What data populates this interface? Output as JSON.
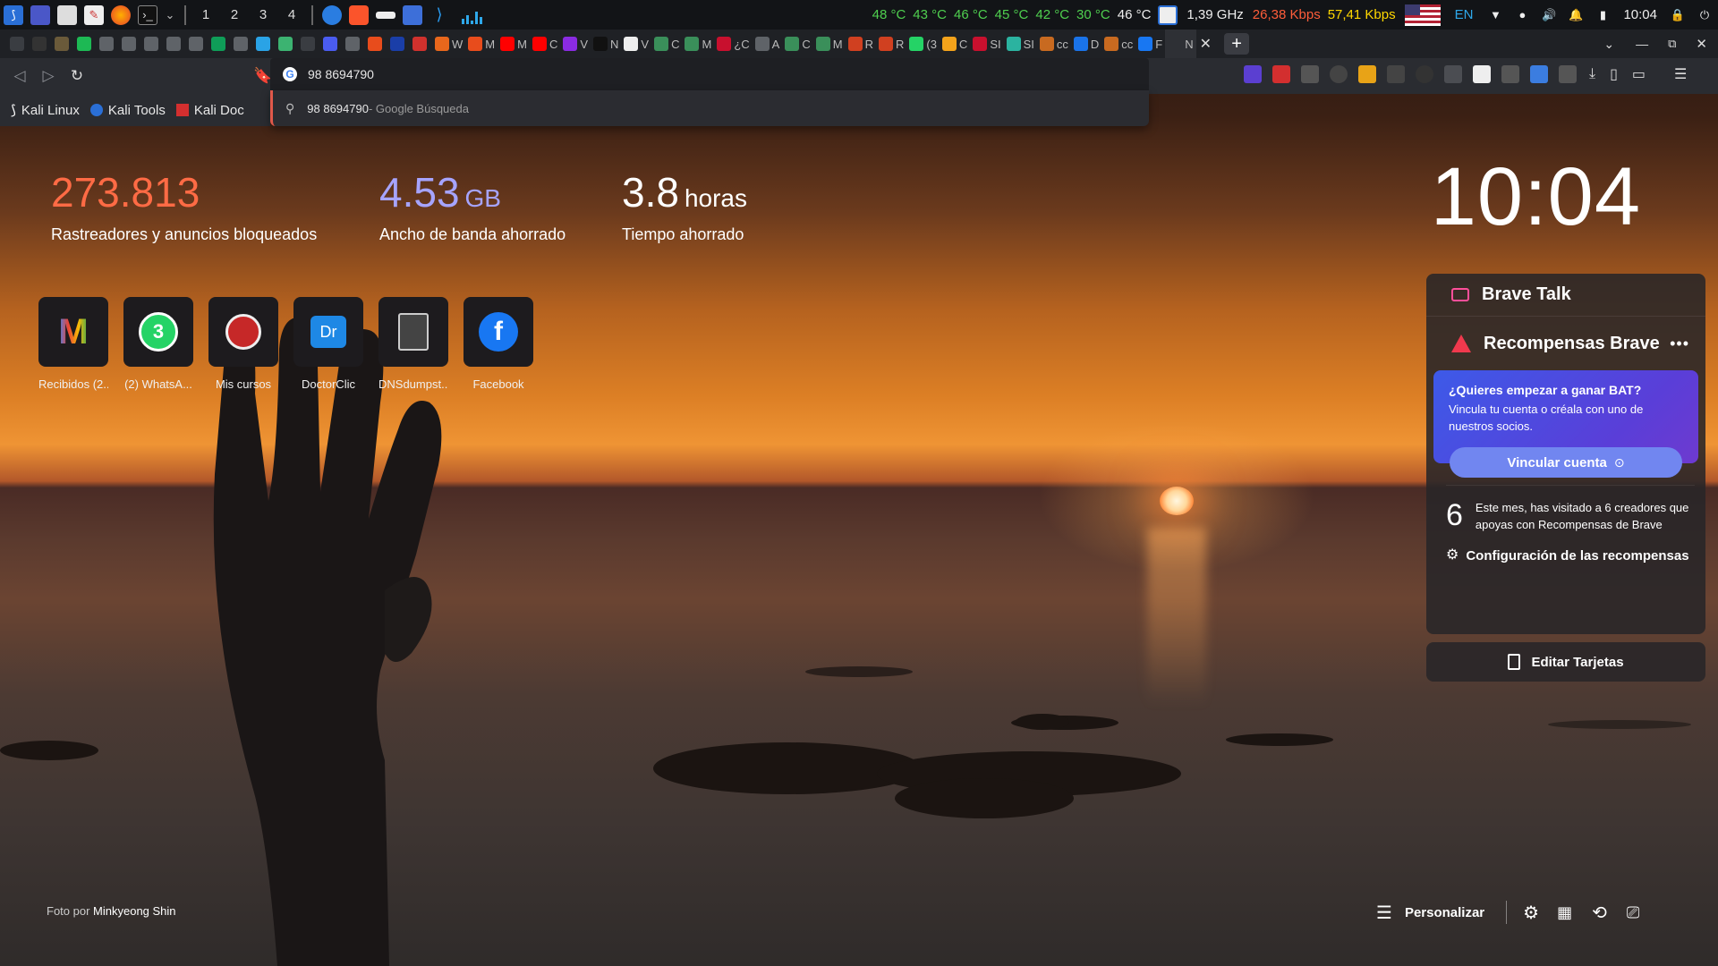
{
  "system_bar": {
    "workspaces": [
      "1",
      "2",
      "3",
      "4"
    ],
    "temps": [
      "48 °C",
      "43 °C",
      "46 °C",
      "45 °C",
      "42 °C",
      "30 °C",
      "46 °C"
    ],
    "cpu_freq": "1,39 GHz",
    "net_down": "26,38 Kbps",
    "net_up": "57,41 Kbps",
    "lang": "EN",
    "time": "10:04"
  },
  "tabs": [
    {
      "label": "",
      "color": "#3a3d42"
    },
    {
      "label": "",
      "color": "#333"
    },
    {
      "label": "",
      "color": "#6a5a3a"
    },
    {
      "label": "",
      "color": "#1db954"
    },
    {
      "label": "",
      "color": "#5f6368"
    },
    {
      "label": "",
      "color": "#5f6368"
    },
    {
      "label": "",
      "color": "#5f6368"
    },
    {
      "label": "",
      "color": "#5f6368"
    },
    {
      "label": "",
      "color": "#5f6368"
    },
    {
      "label": "",
      "color": "#0f9d58"
    },
    {
      "label": "",
      "color": "#5f6368"
    },
    {
      "label": "",
      "color": "#2aa3e6"
    },
    {
      "label": "",
      "color": "#3cb371"
    },
    {
      "label": "",
      "color": "#3a3d42"
    },
    {
      "label": "",
      "color": "#4a5cf0"
    },
    {
      "label": "",
      "color": "#5f6368"
    },
    {
      "label": "",
      "color": "#e84c1c"
    },
    {
      "label": "",
      "color": "#1a3ea8"
    },
    {
      "label": "",
      "color": "#d0312d"
    },
    {
      "label": "W",
      "color": "#e8671c"
    },
    {
      "label": "M",
      "color": "#e84c1c"
    },
    {
      "label": "M",
      "color": "#ff0000"
    },
    {
      "label": "C",
      "color": "#ff0000"
    },
    {
      "label": "V",
      "color": "#8a2be2"
    },
    {
      "label": "N",
      "color": "#111"
    },
    {
      "label": "V",
      "color": "#eee"
    },
    {
      "label": "C",
      "color": "#3a8f5a"
    },
    {
      "label": "M",
      "color": "#3a8f5a"
    },
    {
      "label": "¿C",
      "color": "#c8102e"
    },
    {
      "label": "A",
      "color": "#5f6368"
    },
    {
      "label": "C",
      "color": "#3a8f5a"
    },
    {
      "label": "M",
      "color": "#3a8f5a"
    },
    {
      "label": "R",
      "color": "#d04020"
    },
    {
      "label": "R",
      "color": "#d04020"
    },
    {
      "label": "(3",
      "color": "#25d366"
    },
    {
      "label": "C",
      "color": "#f4a31b"
    },
    {
      "label": "SI",
      "color": "#c8102e"
    },
    {
      "label": "SI",
      "color": "#2bb3a0"
    },
    {
      "label": "cc",
      "color": "#c86a20"
    },
    {
      "label": "D",
      "color": "#1a73e8"
    },
    {
      "label": "cc",
      "color": "#c86a20"
    },
    {
      "label": "F",
      "color": "#1877f2"
    },
    {
      "label": "N",
      "color": "#2e3035"
    }
  ],
  "toolbar": {
    "omnibox_value": "98 8694790",
    "suggestion_query": "98 8694790",
    "suggestion_source": " - Google Búsqueda"
  },
  "bookmarks": [
    {
      "label": "Kali Linux"
    },
    {
      "label": "Kali Tools"
    },
    {
      "label": "Kali Doc"
    }
  ],
  "stats": {
    "trackers_value": "273.813",
    "trackers_label": "Rastreadores y anuncios bloqueados",
    "bandwidth_value": "4.53",
    "bandwidth_unit": "GB",
    "bandwidth_label": "Ancho de banda ahorrado",
    "time_value": "3.8",
    "time_unit": "horas",
    "time_label": "Tiempo ahorrado"
  },
  "clock": "10:04",
  "top_sites": [
    {
      "label": "Recibidos (2..."
    },
    {
      "label": "(2) WhatsA..."
    },
    {
      "label": "Mis cursos"
    },
    {
      "label": "DoctorClic"
    },
    {
      "label": "DNSdumpst..."
    },
    {
      "label": "Facebook"
    }
  ],
  "cards": {
    "brave_talk": "Brave Talk",
    "rewards_title": "Recompensas Brave",
    "rewards_prompt_title": "¿Quieres empezar a ganar BAT?",
    "rewards_prompt_body": "Vincula tu cuenta o créala con uno de nuestros socios.",
    "rewards_button": "Vincular cuenta",
    "creators_count": "6",
    "creators_text": "Este mes, has visitado a 6 creadores que apoyas con Recompensas de Brave",
    "rewards_settings": "Configuración de las recompensas",
    "edit_cards": "Editar Tarjetas"
  },
  "footer": {
    "photo_credit_prefix": "Foto por ",
    "photo_credit_name": "Minkyeong Shin",
    "customize": "Personalizar"
  }
}
